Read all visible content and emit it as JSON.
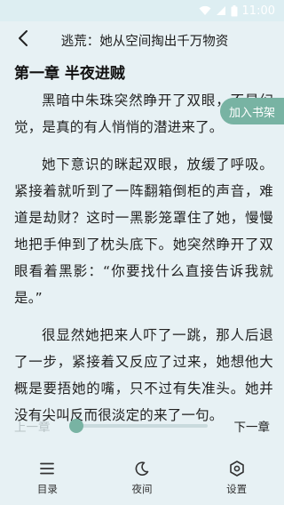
{
  "status_bar": {
    "time": "11:00",
    "icons": [
      "wifi-icon",
      "signal-icon",
      "battery-icon"
    ]
  },
  "header": {
    "back_icon": "chevron-left-icon",
    "title": "逃荒：她从空间掏出千万物资"
  },
  "chapter": {
    "title": "第一章 半夜进贼",
    "paragraphs": [
      "黑暗中朱珠突然睁开了双眼，不是幻觉，是真的有人悄悄的潜进来了。",
      "她下意识的眯起双眼，放缓了呼吸。紧接着就听到了一阵翻箱倒柜的声音，难道是劫财？这时一黑影笼罩住了她，慢慢地把手伸到了枕头底下。她突然睁开了双眼看着黑影：“你要找什么直接告诉我就是。”",
      "很显然她把来人吓了一跳，那人后退了一步，紧接着又反应了过来，她想他大概是要捂她的嘴，只不过有失准头。她并没有尖叫反而很淡定的来了一句。"
    ]
  },
  "add_shelf": {
    "label": "加入书架"
  },
  "progress": {
    "prev_label": "上一章",
    "next_label": "下一章",
    "value": 0.0
  },
  "bottom_nav": {
    "items": [
      {
        "label": "目录",
        "icon": "menu-icon"
      },
      {
        "label": "夜间",
        "icon": "moon-icon"
      },
      {
        "label": "设置",
        "icon": "settings-icon"
      }
    ]
  },
  "colors": {
    "background": "#e7f1f4",
    "accent": "#78b3a3",
    "disabled_text": "#b7c2c5"
  }
}
